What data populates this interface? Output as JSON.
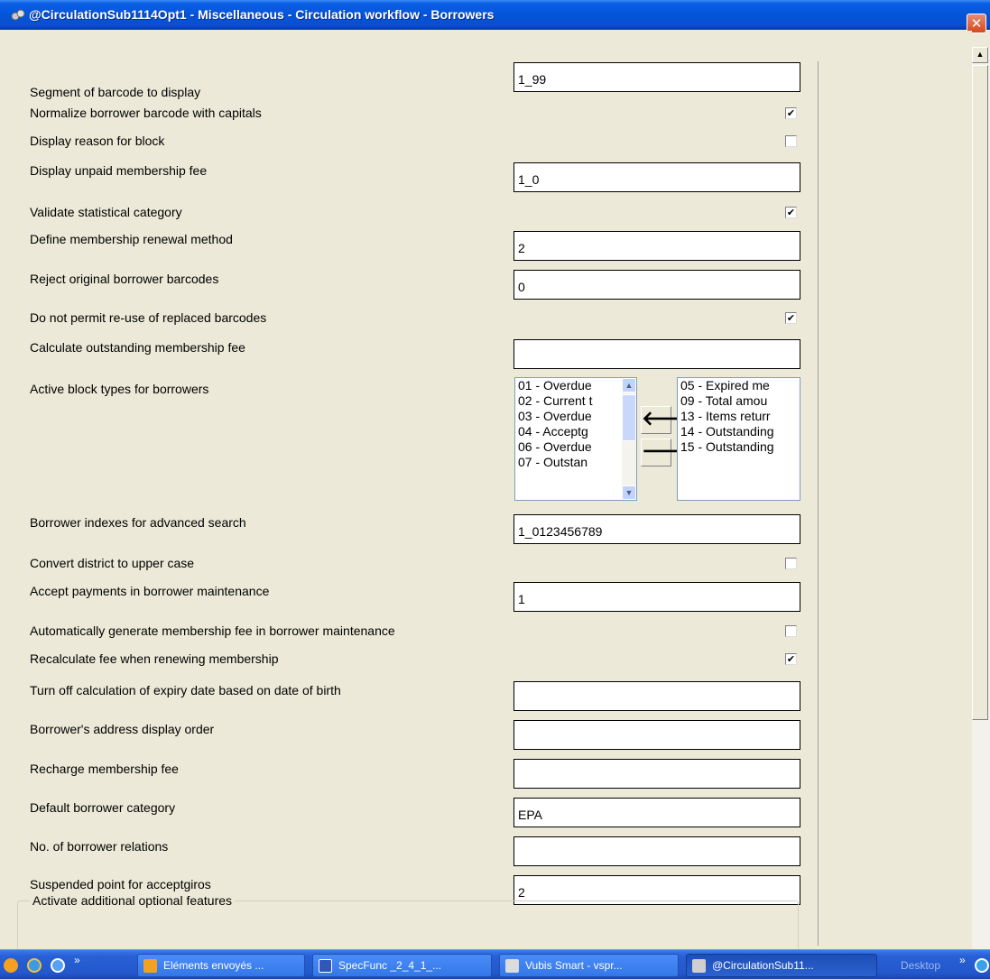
{
  "window": {
    "title": "@CirculationSub1114Opt1 - Miscellaneous - Circulation workflow - Borrowers",
    "close_symbol": "✕"
  },
  "settings": [
    {
      "label": "Segment of barcode to display",
      "type": "text",
      "value": "1_99"
    },
    {
      "label": "Normalize borrower barcode with capitals",
      "type": "checkbox",
      "checked": true
    },
    {
      "label": "Display reason for block",
      "type": "checkbox",
      "checked": false
    },
    {
      "label": "Display unpaid membership fee",
      "type": "text",
      "value": "1_0"
    },
    {
      "label": "Validate statistical category",
      "type": "checkbox",
      "checked": true
    },
    {
      "label": "Define membership renewal method",
      "type": "text",
      "value": "2"
    },
    {
      "label": "Reject original borrower barcodes",
      "type": "text",
      "value": "0"
    },
    {
      "label": "Do not permit re-use of replaced barcodes",
      "type": "checkbox",
      "checked": true
    },
    {
      "label": "Calculate outstanding membership fee",
      "type": "text",
      "value": ""
    },
    {
      "label": "Active block types for borrowers",
      "type": "dual-list"
    },
    {
      "label": "Borrower indexes for advanced search",
      "type": "text",
      "value": "1_0123456789"
    },
    {
      "label": "Convert district to upper case",
      "type": "checkbox",
      "checked": false
    },
    {
      "label": "Accept payments in borrower maintenance",
      "type": "text",
      "value": "1"
    },
    {
      "label": "Automatically generate membership fee in borrower maintenance",
      "type": "checkbox",
      "checked": false
    },
    {
      "label": "Recalculate fee when renewing membership",
      "type": "checkbox",
      "checked": true
    },
    {
      "label": "Turn off calculation of expiry date based on date of birth",
      "type": "text",
      "value": ""
    },
    {
      "label": "Borrower's address display order",
      "type": "text",
      "value": ""
    },
    {
      "label": "Recharge membership fee",
      "type": "text",
      "value": ""
    },
    {
      "label": "Default borrower category",
      "type": "text",
      "value": "EPA"
    },
    {
      "label": "No. of borrower relations",
      "type": "text",
      "value": ""
    },
    {
      "label": "Suspended point for acceptgiros",
      "type": "text",
      "value": "2"
    }
  ],
  "block_types": {
    "available": [
      "01 - Overdue",
      "02 - Current t",
      "03 - Overdue",
      "04 - Acceptg",
      "06 - Overdue",
      "07 - Outstan"
    ],
    "selected": [
      "05 - Expired me",
      "09 - Total amou",
      "13 - Items returr",
      "14 - Outstanding",
      "15 - Outstanding"
    ],
    "move_left_symbol": "🡐",
    "move_right_symbol": "🡒"
  },
  "group_box": {
    "legend": "Activate additional optional features"
  },
  "taskbar": {
    "tasks": [
      {
        "label": "Eléments envoyés ...",
        "icon": "outlook-icon"
      },
      {
        "label": "SpecFunc _2_4_1_...",
        "icon": "word-icon"
      },
      {
        "label": "Vubis Smart - vspr...",
        "icon": "vubis-icon"
      },
      {
        "label": "@CirculationSub11...",
        "icon": "app-icon"
      }
    ],
    "desktop_label": "Desktop"
  }
}
